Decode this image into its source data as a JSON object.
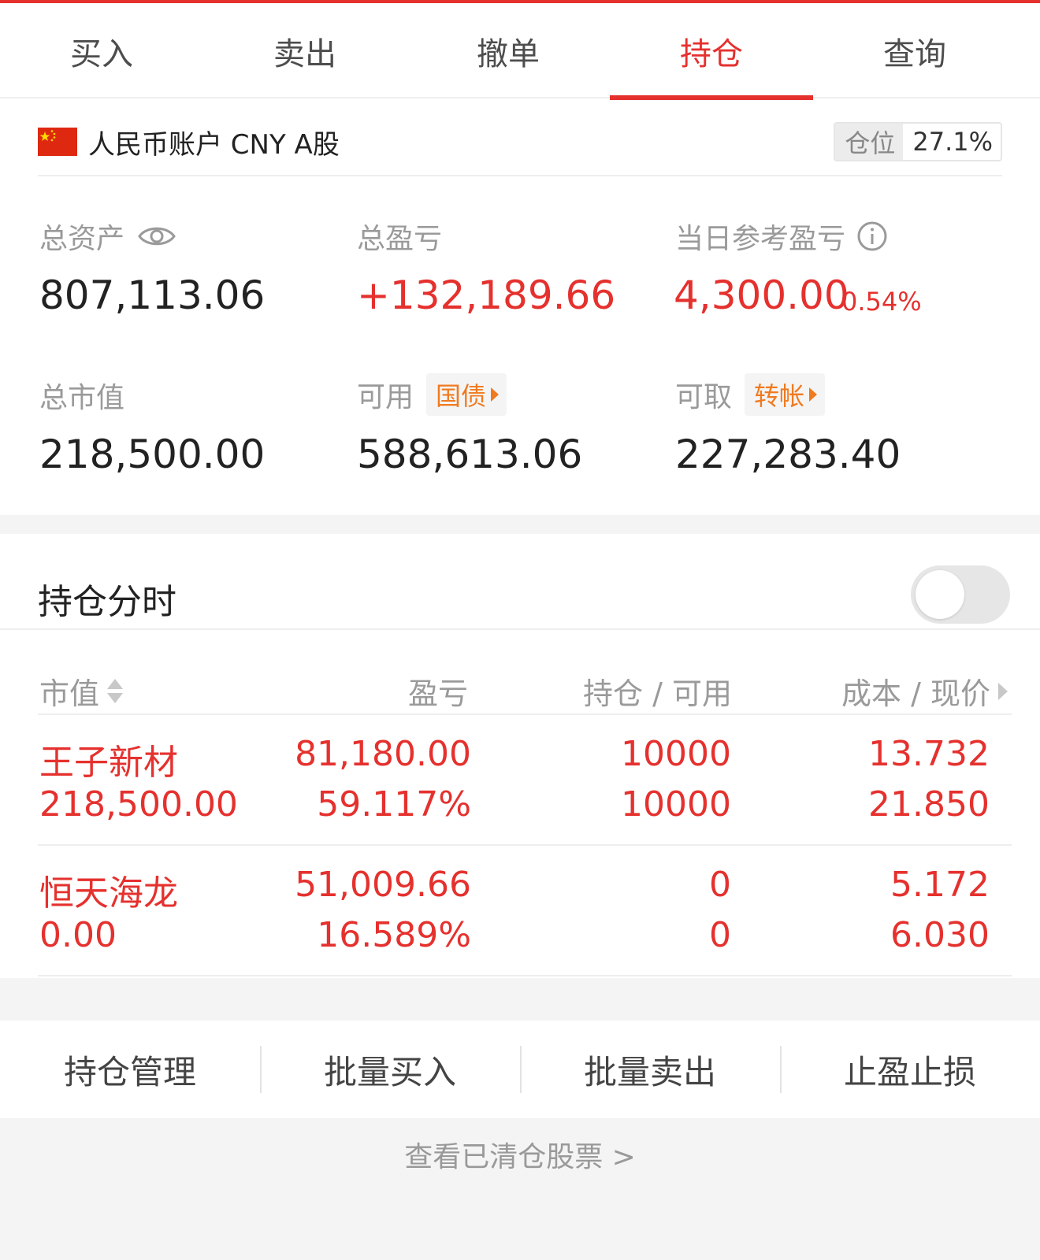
{
  "tabs": [
    {
      "label": "买入",
      "active": false
    },
    {
      "label": "卖出",
      "active": false
    },
    {
      "label": "撤单",
      "active": false
    },
    {
      "label": "持仓",
      "active": true
    },
    {
      "label": "查询",
      "active": false
    }
  ],
  "account": {
    "flag_icon": "china-flag-icon",
    "name": "人民币账户 CNY A股",
    "position_label": "仓位",
    "position_value": "27.1%"
  },
  "summary": {
    "total_assets_label": "总资产",
    "total_assets_value": "807,113.06",
    "total_pnl_label": "总盈亏",
    "total_pnl_value": "+132,189.66",
    "daily_pnl_label": "当日参考盈亏",
    "daily_pnl_value": "4,300.00",
    "daily_pnl_pct": "0.54%",
    "market_value_label": "总市值",
    "market_value_value": "218,500.00",
    "available_label": "可用",
    "available_chip": "国债",
    "available_value": "588,613.06",
    "withdrawable_label": "可取",
    "withdrawable_chip": "转帐",
    "withdrawable_value": "227,283.40"
  },
  "section": {
    "title": "持仓分时",
    "toggle_on": false
  },
  "table": {
    "headers": [
      "市值",
      "盈亏",
      "持仓 / 可用",
      "成本 / 现价"
    ],
    "rows": [
      {
        "name": "王子新材",
        "market_value": "218,500.00",
        "pnl": "81,180.00",
        "pnl_pct": "59.117%",
        "holding": "10000",
        "available": "10000",
        "cost": "13.732",
        "price": "21.850"
      },
      {
        "name": "恒天海龙",
        "market_value": "0.00",
        "pnl": "51,009.66",
        "pnl_pct": "16.589%",
        "holding": "0",
        "available": "0",
        "cost": "5.172",
        "price": "6.030"
      }
    ]
  },
  "actions": [
    "持仓管理",
    "批量买入",
    "批量卖出",
    "止盈止损"
  ],
  "footer_link": "查看已清仓股票 >",
  "colors": {
    "accent": "#e5312e",
    "chip": "#f07a1f"
  }
}
